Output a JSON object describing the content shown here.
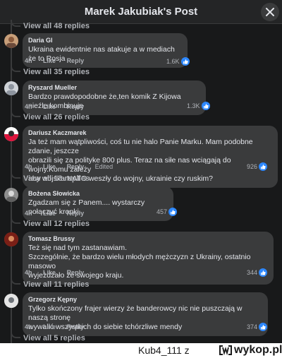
{
  "header": {
    "title": "Marek Jakubiak's Post"
  },
  "top_view_all": "View all 48 replies",
  "comments": [
    {
      "author": "Daria Gl",
      "text": "Ukraina ewidentnie nas atakuje a w mediach że to Rosja",
      "time": "4h",
      "like": "Like",
      "reply": "Reply",
      "edited": "",
      "reactions": "1.6K",
      "view_all": "View all 35 replies",
      "avatar_color": "#c89f7a"
    },
    {
      "author": "Ryszard Mueller",
      "text": "Bardzo prawdopodobne że,ten komik Z Kijowa nieźle kombinuje",
      "time": "4h",
      "like": "Like",
      "reply": "Reply",
      "edited": "",
      "reactions": "1.3K",
      "view_all": "View all 26 replies",
      "avatar_color": "#cfd3d8"
    },
    {
      "author": "Dariusz Kaczmarek",
      "text_lines": [
        "Ja też mam wątpliwości, coś tu nie halo Panie Marku. Mam podobne zdanie, jeszcze",
        "obrazili się za polityke 800 plus. Teraz na siłe nas wciągają do wojny.Komu zależy",
        "aby wojska NATO weszły do wojny, ukrainie czy ruskim?"
      ],
      "time": "4h",
      "like": "Like",
      "reply": "Reply",
      "edited": "Edited",
      "reactions": "926",
      "view_all": "View all 13 replies",
      "avatar_color": "#c0392b"
    },
    {
      "author": "Bożena Słowicka",
      "text": "Zgadzam się z Panem.... wystarczy połączyć kropki.",
      "time": "4h",
      "like": "Like",
      "reply": "Reply",
      "edited": "",
      "reactions": "457",
      "view_all": "View all 12 replies",
      "avatar_color": "#8f8f8f"
    },
    {
      "author": "Tomasz Brussy",
      "text_lines": [
        "Też się nad tym zastanawiam.",
        "Szczególnie, że bardzo wielu młodych mężczyzn z Ukrainy, ostatnio masowo",
        "wyjeżdżało ze swojego kraju."
      ],
      "time": "4h",
      "like": "Like",
      "reply": "Reply",
      "edited": "",
      "reactions": "344",
      "view_all": "View all 11 replies",
      "avatar_color": "#b03a2e"
    },
    {
      "author": "Grzegorz Kępny",
      "text_lines": [
        "Tylko skończony frajer wierzy że banderowcy nic nie puszczają w naszą stronę",
        "wywalić wszystkich do siebie tchórzliwe mendy"
      ],
      "time": "4h",
      "like": "Like",
      "reply": "Reply",
      "edited": "",
      "reactions": "374",
      "view_all": "View all 5 replies",
      "avatar_color": "#9aa0a6"
    }
  ],
  "watermark": {
    "user": "Kub4_111  z",
    "site": "wykop.pl"
  },
  "colors": {
    "background": "#18191a",
    "bubble": "#3a3b3c",
    "like_blue": "#2d88ff"
  }
}
